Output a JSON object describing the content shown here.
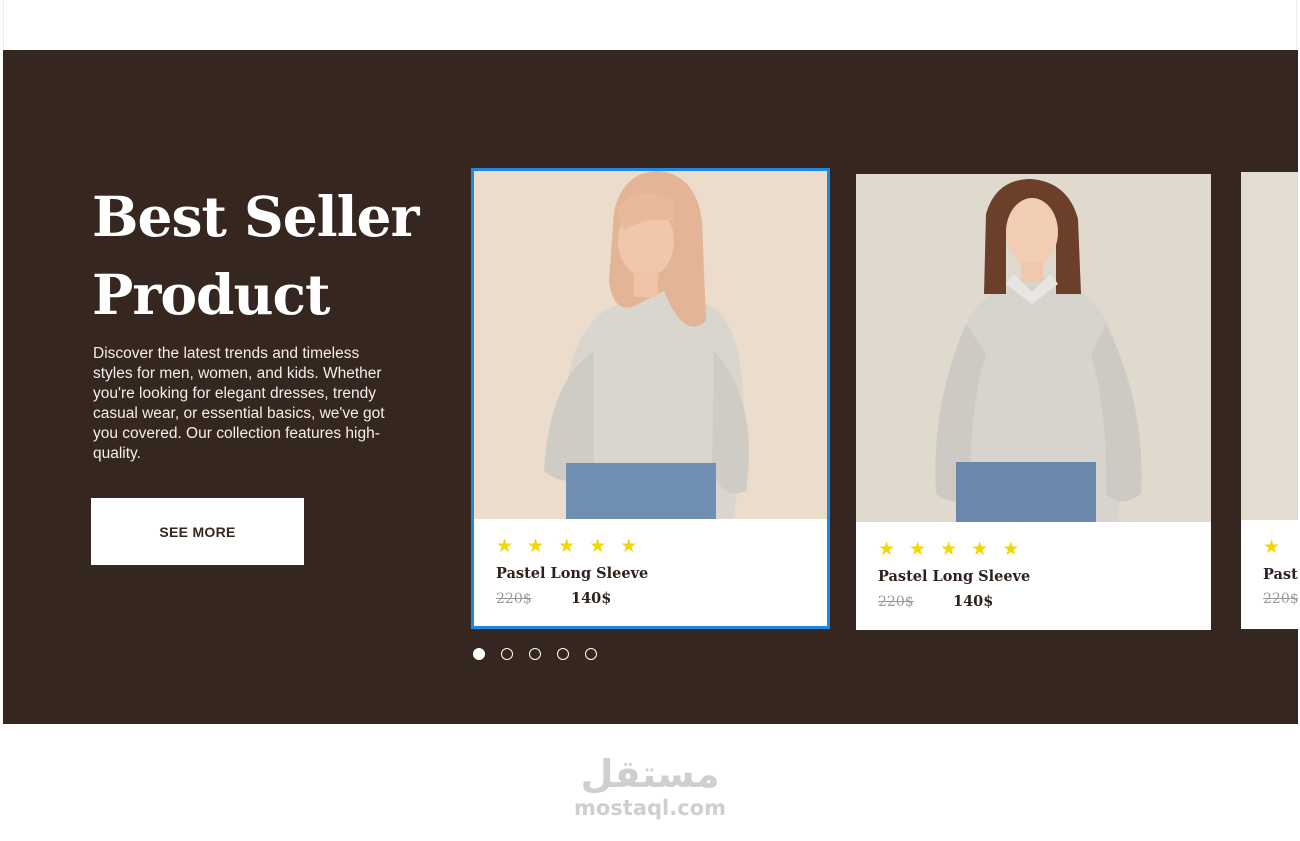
{
  "hero": {
    "title_line1": "Best Seller",
    "title_line2": "Product",
    "description": "Discover the latest trends and timeless styles for men, women, and kids. Whether you're looking for elegant dresses, trendy casual wear, or essential basics, we've got you covered. Our collection features high-quality.",
    "button_label": "SEE MORE",
    "background_color": "#352620"
  },
  "products": [
    {
      "name": "Pastel Long Sleeve",
      "old_price": "220$",
      "new_price": "140$",
      "rating": 5,
      "stars": "★",
      "selected": true
    },
    {
      "name": "Pastel Long Sleeve",
      "old_price": "220$",
      "new_price": "140$",
      "rating": 5,
      "stars": "★",
      "selected": false
    },
    {
      "name": "Paste",
      "old_price": "220$",
      "new_price": "",
      "rating": 1,
      "stars": "★",
      "selected": false
    }
  ],
  "carousel": {
    "page_count": 5,
    "active_index": 0
  },
  "watermark": {
    "arabic": "مستقل",
    "latin": "mostaql.com"
  },
  "colors": {
    "accent_selection": "#1e88e5",
    "star": "#f2d800",
    "text_dark": "#2e221c",
    "strike": "#9a9a9a"
  }
}
